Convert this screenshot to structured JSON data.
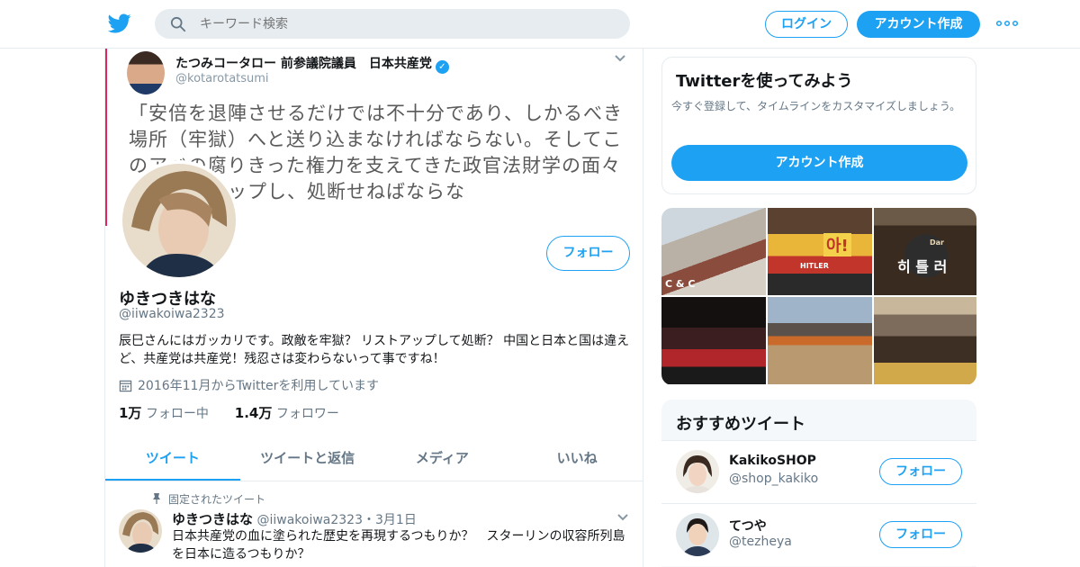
{
  "header": {
    "search_placeholder": "キーワード検索",
    "login_label": "ログイン",
    "signup_label": "アカウント作成"
  },
  "banner": {
    "name": "たつみコータロー 前参議院議員　日本共産党",
    "handle": "@kotarotatsumi",
    "text": "「安倍を退陣させるだけでは不十分であり、しかるべき場所（牢獄）へと送り込まなければならない。そしてこのアベの腐りきった権力を支えてきた政官法財学の面々をリストアップし、処断せねばならな"
  },
  "profile": {
    "name": "ゆきつきはな",
    "handle": "@iiwakoiwa2323",
    "follow_label": "フォロー",
    "bio": "辰巳さんにはガッカリです。政敵を牢獄？ リストアップして処断？ 中国と日本と国は違えど、共産党は共産党！残忍さは変わらないって事ですね！",
    "joined": "2016年11月からTwitterを利用しています",
    "following_count": "1万",
    "following_label": "フォロー中",
    "followers_count": "1.4万",
    "followers_label": "フォロワー"
  },
  "tabs": [
    {
      "label": "ツイート"
    },
    {
      "label": "ツイートと返信"
    },
    {
      "label": "メディア"
    },
    {
      "label": "いいね"
    }
  ],
  "pinned_tweet": {
    "pinned_label": "固定されたツイート",
    "name": "ゆきつきはな",
    "handle": "@iiwakoiwa2323",
    "date": "・3月1日",
    "text": "日本共産党の血に塗られた歴史を再現するつもりか？　スターリンの収容所列島を日本に造るつもりか？"
  },
  "try_twitter": {
    "title": "Twitterを使ってみよう",
    "description": "今すぐ登録して、タイムラインをカスタマイズしましょう。",
    "button_label": "アカウント作成"
  },
  "media": {
    "sign_labels": [
      "아!",
      "HITLER",
      "Dar",
      "히 틀 러",
      "C & C"
    ]
  },
  "recommended": {
    "title": "おすすめツイート",
    "users": [
      {
        "name": "KakikoSHOP",
        "handle": "@shop_kakiko",
        "follow_label": "フォロー"
      },
      {
        "name": "てつや",
        "handle": "@tezheya",
        "follow_label": "フォロー"
      }
    ]
  },
  "colors": {
    "accent": "#1da1f2",
    "text": "#14171a",
    "secondary": "#657786",
    "border": "#e6ecf0",
    "banner_border": "#e0245e"
  },
  "icons": [
    "twitter-bird-icon",
    "search-icon",
    "more-dots-icon",
    "verified-icon",
    "chevron-down-icon",
    "calendar-icon",
    "pin-icon"
  ]
}
